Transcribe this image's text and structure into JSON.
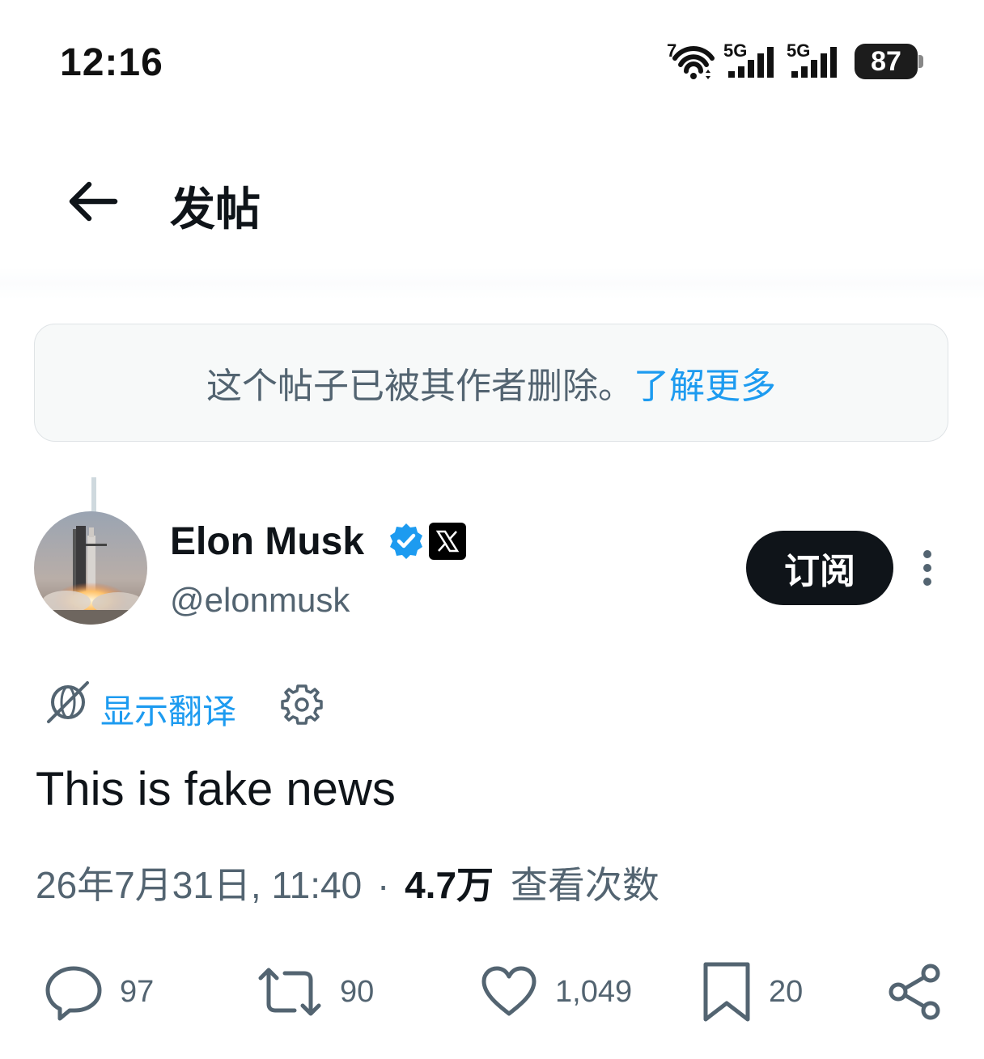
{
  "status_bar": {
    "time": "12:16",
    "wifi_label": "7",
    "sim1_label": "5G",
    "sim2_label": "5G",
    "battery": "87"
  },
  "header": {
    "title": "发帖",
    "back_icon": "arrow-left-icon"
  },
  "deleted_notice": {
    "text": "这个帖子已被其作者删除。",
    "link": "了解更多"
  },
  "post": {
    "author_name": "Elon Musk",
    "author_handle": "@elonmusk",
    "subscribe_label": "订阅",
    "translate_label": "显示翻译",
    "text": "This is fake news",
    "date": "26年7月31日, 11:40",
    "separator": "·",
    "views_count": "4.7万",
    "views_label": "查看次数"
  },
  "actions": {
    "reply_count": "97",
    "repost_count": "90",
    "like_count": "1,049",
    "bookmark_count": "20"
  },
  "colors": {
    "accent": "#1d9bf0",
    "text": "#0f1419",
    "secondary": "#536471",
    "notice_bg": "#f7f9f9"
  }
}
